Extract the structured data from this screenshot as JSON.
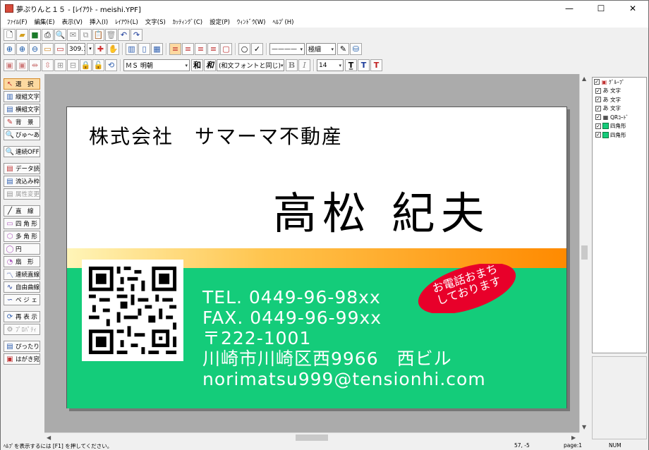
{
  "window": {
    "title": "夢ぷりんと１５ - [ﾚｲｱｳﾄ - meishi.YPF]",
    "minimize": "—",
    "maximize": "☐",
    "close": "✕"
  },
  "menu": [
    "ﾌｧｲﾙ(F)",
    "編集(E)",
    "表示(V)",
    "挿入(I)",
    "ﾚｲｱｳﾄ(L)",
    "文字(S)",
    "ｶｯﾃｨﾝｸﾞ(C)",
    "設定(P)",
    "ｳｨﾝﾄﾞｳ(W)",
    "ﾍﾙﾌﾟ(H)"
  ],
  "toolbar": {
    "zoom_value": "309.1",
    "line_style": "————",
    "line_width": "極細",
    "font_name": "ＭＳ 明朝",
    "font_sub": "(和文フォントと同じ)",
    "font_size": "14",
    "bold": "B",
    "italic": "I",
    "btn_wa1": "和",
    "btn_wa2": "和"
  },
  "left_tools": [
    {
      "label": "選　択",
      "icon": "arrow-pointer-icon",
      "selected": true
    },
    {
      "label": "縦組文字",
      "icon": "vertical-text-icon"
    },
    {
      "label": "横組文字",
      "icon": "horizontal-text-icon"
    },
    {
      "label": "背　景",
      "icon": "background-icon"
    },
    {
      "label": "びゅ～あ",
      "icon": "viewer-icon"
    },
    {
      "label": "連続OFF",
      "icon": "continuous-icon"
    },
    {
      "label": "データ読込",
      "icon": "data-load-icon"
    },
    {
      "label": "流込み枠",
      "icon": "flow-frame-icon"
    },
    {
      "label": "属性変更",
      "icon": "attribute-icon",
      "disabled": true
    },
    {
      "label": "直　線",
      "icon": "line-icon"
    },
    {
      "label": "四 角 形",
      "icon": "rectangle-icon"
    },
    {
      "label": "多 角 形",
      "icon": "polygon-icon"
    },
    {
      "label": "円",
      "icon": "circle-icon"
    },
    {
      "label": "扇　形",
      "icon": "fan-icon"
    },
    {
      "label": "連続直線",
      "icon": "polyline-icon"
    },
    {
      "label": "自由曲線",
      "icon": "freecurve-icon"
    },
    {
      "label": "ベ ジ ェ",
      "icon": "bezier-icon"
    },
    {
      "label": "再 表 示",
      "icon": "redraw-icon"
    },
    {
      "label": "ﾌﾟﾛﾊﾟﾃｨ",
      "icon": "property-icon",
      "disabled": true
    },
    {
      "label": "ぴったり枠",
      "icon": "fit-frame-icon"
    },
    {
      "label": "はがき宛名",
      "icon": "postcard-icon"
    }
  ],
  "card": {
    "company": "株式会社　サマーマ不動産",
    "person": "高松 紀夫",
    "contact_lines": [
      "TEL. 0449-96-98xx",
      "FAX. 0449-96-99xx",
      "〒222-1001",
      "川崎市川崎区西9966　西ビル",
      "norimatsu999@tensionhi.com"
    ],
    "bubble_line1": "お電話おまち",
    "bubble_line2": "しております",
    "colors": {
      "green": "#14cc7a",
      "band_start": "#fff5b8",
      "band_end": "#ff8a00",
      "bubble": "#e8002a"
    }
  },
  "objects": [
    {
      "label": "ｸﾞﾙｰﾌﾟ",
      "icon": "group-icon",
      "checked": true
    },
    {
      "label": "文字",
      "icon": "text-a-icon",
      "checked": true
    },
    {
      "label": "文字",
      "icon": "text-a-icon",
      "checked": true
    },
    {
      "label": "文字",
      "icon": "text-a-icon",
      "checked": true
    },
    {
      "label": "QRｺｰﾄﾞ",
      "icon": "qr-icon",
      "checked": true
    },
    {
      "label": "四角形",
      "icon": "green-rect-icon",
      "checked": true
    },
    {
      "label": "四角形",
      "icon": "green-rect-icon",
      "checked": true
    }
  ],
  "status": {
    "help": "ﾍﾙﾌﾟを表示するには [F1] を押してください。",
    "coords": "57,  -5",
    "page": "page:1",
    "num": "NUM"
  }
}
